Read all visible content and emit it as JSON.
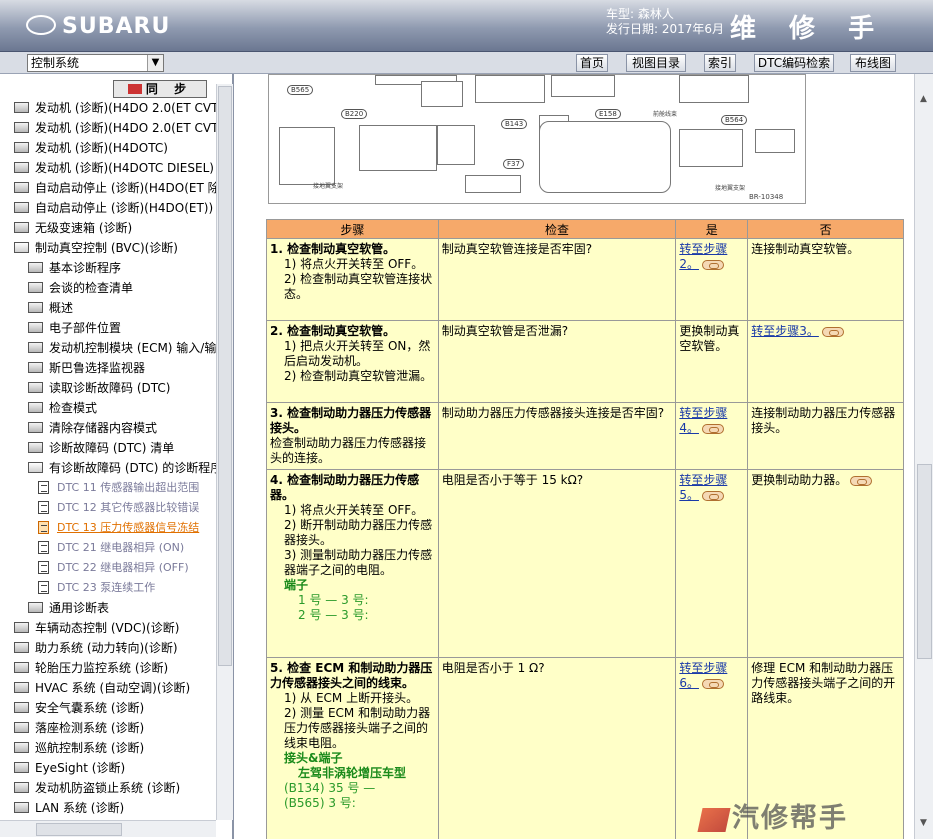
{
  "header": {
    "brand": "SUBARU",
    "car_model": "车型: 森林人",
    "release_date": "发行日期: 2017年6月",
    "manual_title": "维 修 手 册"
  },
  "toolbar": {
    "system_select_value": "控制系统",
    "nav_buttons": [
      "首页",
      "视图目录",
      "索引",
      "DTC编码检索",
      "布线图"
    ]
  },
  "sidebar": {
    "sync_label": "同 步",
    "items": [
      "发动机 (诊断)(H4DO 2.0(ET CVT",
      "发动机 (诊断)(H4DO 2.0(ET CVT)",
      "发动机 (诊断)(H4DOTC)",
      "发动机 (诊断)(H4DOTC DIESEL)",
      "自动启动停止 (诊断)(H4DO(ET 除",
      "自动启动停止 (诊断)(H4DO(ET))",
      "无级变速箱 (诊断)",
      "制动真空控制 (BVC)(诊断)",
      "基本诊断程序",
      "会谈的检查清单",
      "概述",
      "电子部件位置",
      "发动机控制模块 (ECM) 输入/输",
      "斯巴鲁选择监视器",
      "读取诊断故障码 (DTC)",
      "检查模式",
      "清除存储器内容模式",
      "诊断故障码 (DTC) 清单",
      "有诊断故障码 (DTC) 的诊断程序",
      "DTC 11 传感器输出超出范围",
      "DTC 12 其它传感器比较错误",
      "DTC 13 压力传感器信号冻结",
      "DTC 21 继电器相异 (ON)",
      "DTC 22 继电器相异 (OFF)",
      "DTC 23 泵连续工作",
      "通用诊断表",
      "车辆动态控制 (VDC)(诊断)",
      "助力系统 (动力转向)(诊断)",
      "轮胎压力监控系统 (诊断)",
      "HVAC 系统 (自动空调)(诊断)",
      "安全气囊系统 (诊断)",
      "落座检测系统 (诊断)",
      "巡航控制系统 (诊断)",
      "EyeSight (诊断)",
      "发动机防盗锁止系统 (诊断)",
      "LAN 系统 (诊断)"
    ]
  },
  "diagram": {
    "connector_labels": [
      "B565",
      "B220",
      "B143",
      "F37",
      "E158",
      "B564"
    ],
    "caption_left": "接地翼支架",
    "caption_right": "接地翼支架",
    "caption_mid": "前舱线束",
    "ref_code": "BR-10348"
  },
  "table": {
    "headers": [
      "步骤",
      "检查",
      "是",
      "否"
    ],
    "rows": [
      {
        "title": "1. 检查制动真空软管。",
        "lines": [
          "1) 将点火开关转至 OFF。",
          "2) 检查制动真空软管连接状态。"
        ],
        "check": "制动真空软管连接是否牢固?",
        "yes": "转至步骤2。",
        "yes_link": true,
        "no": "连接制动真空软管。",
        "no_link": false
      },
      {
        "title": "2. 检查制动真空软管。",
        "lines": [
          "1) 把点火开关转至 ON，然后启动发动机。",
          "2) 检查制动真空软管泄漏。"
        ],
        "check": "制动真空软管是否泄漏?",
        "yes": "更换制动真空软管。",
        "yes_link": false,
        "no": "转至步骤3。",
        "no_link": true
      },
      {
        "title": "3. 检查制动助力器压力传感器接头。",
        "lines": [
          "检查制动助力器压力传感器接头的连接。"
        ],
        "check": "制动助力器压力传感器接头连接是否牢固?",
        "yes": "转至步骤4。",
        "yes_link": true,
        "no": "连接制动助力器压力传感器接头。",
        "no_link": false
      },
      {
        "title": "4. 检查制动助力器压力传感器。",
        "lines": [
          "1) 将点火开关转至 OFF。",
          "2) 断开制动助力器压力传感器接头。",
          "3) 测量制动助力器压力传感器端子之间的电阻。"
        ],
        "terminal_head": "端子",
        "terminal_lines": [
          "1 号 — 3 号:",
          "2 号 — 3 号:"
        ],
        "check": "电阻是否小于等于 15 kΩ?",
        "yes": "转至步骤5。",
        "yes_link": true,
        "no": "更换制动助力器。",
        "no_link": false
      },
      {
        "title": "5. 检查 ECM 和制动助力器压力传感器接头之间的线束。",
        "lines": [
          "1) 从 ECM 上断开接头。",
          "2) 测量 ECM 和制动助力器压力传感器接头端子之间的线束电阻。"
        ],
        "terminal_head": "接头&端子",
        "terminal_sub": "左驾非涡轮增压车型",
        "terminal_lines": [
          "(B134) 35 号 —",
          "(B565) 3 号:"
        ],
        "check": "电阻是否小于 1 Ω?",
        "yes": "转至步骤6。",
        "yes_link": true,
        "no": "修理 ECM 和制动助力器压力传感器接头端子之间的开路线束。",
        "no_link": false
      }
    ]
  },
  "watermark": "汽修帮手"
}
